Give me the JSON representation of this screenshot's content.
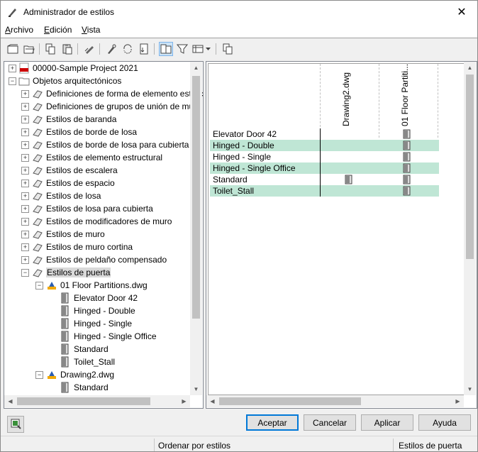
{
  "window": {
    "title": "Administrador de estilos",
    "close_glyph": "✕"
  },
  "menu": [
    {
      "label": "Archivo",
      "underline": "A"
    },
    {
      "label": "Edición",
      "underline": "E"
    },
    {
      "label": "Vista",
      "underline": "V"
    }
  ],
  "toolbar": {
    "buttons": [
      "new-drawing-icon",
      "open-drawing-icon",
      "copy-icon",
      "paste-icon",
      "edit-style-icon",
      "purge-styles-icon",
      "synchronize-icon",
      "set-from-icon",
      "toggle-view-icon",
      "filter-icon",
      "table-view-icon",
      "drawing-sort-icon"
    ]
  },
  "tree": {
    "project": "00000-Sample Project 2021",
    "root": "Objetos arquitectónicos",
    "categories": [
      "Definiciones de forma de elemento estructural",
      "Definiciones de grupos de unión de muro",
      "Estilos de baranda",
      "Estilos de borde de losa",
      "Estilos de borde de losa para cubierta",
      "Estilos de elemento estructural",
      "Estilos de escalera",
      "Estilos de espacio",
      "Estilos de losa",
      "Estilos de losa para cubierta",
      "Estilos de modificadores de muro",
      "Estilos de muro",
      "Estilos de muro cortina",
      "Estilos de peldaño compensado",
      "Estilos de puerta"
    ],
    "drawing1": {
      "name": "01 Floor Partitions.dwg",
      "styles": [
        "Elevator Door 42",
        "Hinged - Double",
        "Hinged - Single",
        "Hinged - Single Office",
        "Standard",
        "Toilet_Stall"
      ]
    },
    "drawing2": {
      "name": "Drawing2.dwg",
      "styles": [
        "Standard"
      ]
    }
  },
  "grid": {
    "columns": [
      "Drawing2.dwg",
      "01 Floor Partiti..."
    ],
    "rows": [
      {
        "label": "Elevator Door 42",
        "in_drawing2": false,
        "in_floor": true
      },
      {
        "label": "Hinged - Double",
        "in_drawing2": false,
        "in_floor": true
      },
      {
        "label": "Hinged - Single",
        "in_drawing2": false,
        "in_floor": true
      },
      {
        "label": "Hinged - Single Office",
        "in_drawing2": false,
        "in_floor": true
      },
      {
        "label": "Standard",
        "in_drawing2": true,
        "in_floor": true
      },
      {
        "label": "Toilet_Stall",
        "in_drawing2": false,
        "in_floor": true
      }
    ],
    "highlight_color": "#bfe6d5"
  },
  "buttons": {
    "ok": "Aceptar",
    "cancel": "Cancelar",
    "apply": "Aplicar",
    "help": "Ayuda"
  },
  "status": {
    "sort": "Ordenar por estilos",
    "selection": "Estilos de puerta"
  }
}
